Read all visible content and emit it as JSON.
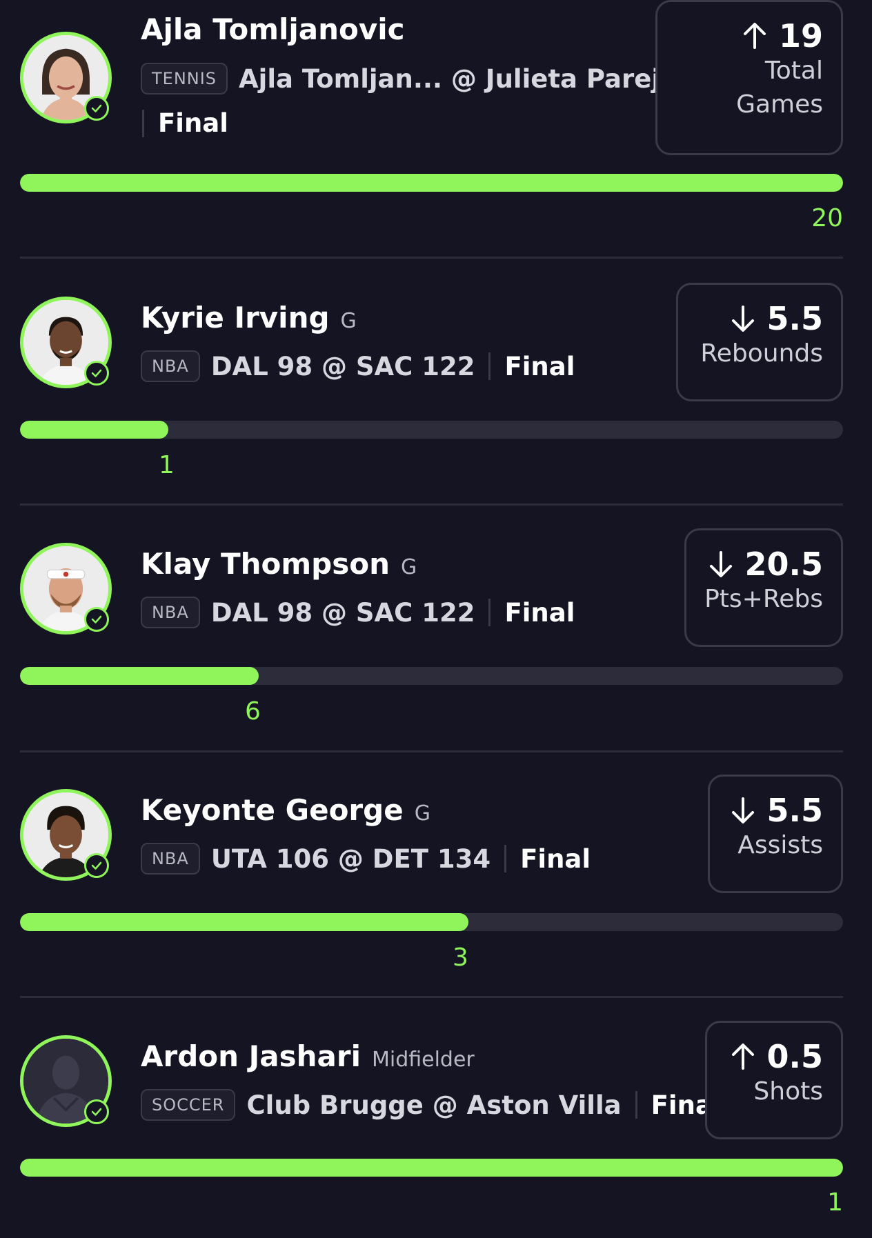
{
  "picks": [
    {
      "player": "Ajla Tomljanovic",
      "position": "",
      "league": "TENNIS",
      "matchup": "Ajla Tomljan... @ Julieta Pareja",
      "status": "Final",
      "direction": "up",
      "line": "19",
      "stat_line1": "Total",
      "stat_line2": "Games",
      "actual": "20",
      "progress": 1.0,
      "avatar": "player-photo-ajla-tomljanovic"
    },
    {
      "player": "Kyrie Irving",
      "position": "G",
      "league": "NBA",
      "matchup": "DAL 98 @ SAC 122",
      "status": "Final",
      "direction": "down",
      "line": "5.5",
      "stat_line1": "Rebounds",
      "stat_line2": "",
      "actual": "1",
      "progress": 0.18,
      "avatar": "player-photo-kyrie-irving"
    },
    {
      "player": "Klay Thompson",
      "position": "G",
      "league": "NBA",
      "matchup": "DAL 98 @ SAC 122",
      "status": "Final",
      "direction": "down",
      "line": "20.5",
      "stat_line1": "Pts+Rebs",
      "stat_line2": "",
      "actual": "6",
      "progress": 0.29,
      "avatar": "player-photo-klay-thompson"
    },
    {
      "player": "Keyonte George",
      "position": "G",
      "league": "NBA",
      "matchup": "UTA 106 @ DET 134",
      "status": "Final",
      "direction": "down",
      "line": "5.5",
      "stat_line1": "Assists",
      "stat_line2": "",
      "actual": "3",
      "progress": 0.545,
      "avatar": "player-photo-keyonte-george"
    },
    {
      "player": "Ardon Jashari",
      "position": "Midfielder",
      "league": "SOCCER",
      "matchup": "Club Brugge @ Aston Villa",
      "status": "Final",
      "direction": "up",
      "line": "0.5",
      "stat_line1": "Shots",
      "stat_line2": "",
      "actual": "1",
      "progress": 1.0,
      "avatar": "player-silhouette-placeholder"
    }
  ],
  "colors": {
    "background": "#141423",
    "accent_green": "#8ff55a",
    "track": "#2c2c3b",
    "border": "#3a3a4a"
  },
  "icons": {
    "check": "check-circle-icon",
    "up": "arrow-up-icon",
    "down": "arrow-down-icon"
  }
}
